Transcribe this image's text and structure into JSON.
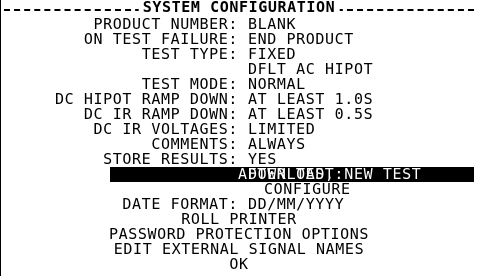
{
  "title": "SYSTEM CONFIGURATION",
  "fields": [
    {
      "label": "PRODUCT NUMBER:",
      "value": "BLANK"
    },
    {
      "label": "ON TEST FAILURE:",
      "value": "END PRODUCT"
    },
    {
      "label": "TEST TYPE:",
      "value": "FIXED"
    },
    {
      "label": "",
      "value": "DFLT AC HIPOT"
    },
    {
      "label": "TEST MODE:",
      "value": "NORMAL"
    },
    {
      "label": "DC HIPOT RAMP DOWN:",
      "value": "AT LEAST 1.0S"
    },
    {
      "label": "DC IR RAMP DOWN:",
      "value": "AT LEAST 0.5S"
    },
    {
      "label": "DC IR VOLTAGES:",
      "value": "LIMITED"
    },
    {
      "label": "COMMENTS:",
      "value": "ALWAYS"
    },
    {
      "label": "STORE RESULTS:",
      "value": "YES"
    }
  ],
  "after_test": {
    "label": "AFTER TEST:",
    "value": "DOWNLOAD, NEW TEST"
  },
  "configure": "CONFIGURE",
  "date_format": {
    "label": "DATE FORMAT:",
    "value": "DD/MM/YYYY"
  },
  "roll_printer": "ROLL PRINTER",
  "password_options": "PASSWORD PROTECTION OPTIONS",
  "edit_signal_names": "EDIT EXTERNAL SIGNAL NAMES",
  "ok": "OK"
}
